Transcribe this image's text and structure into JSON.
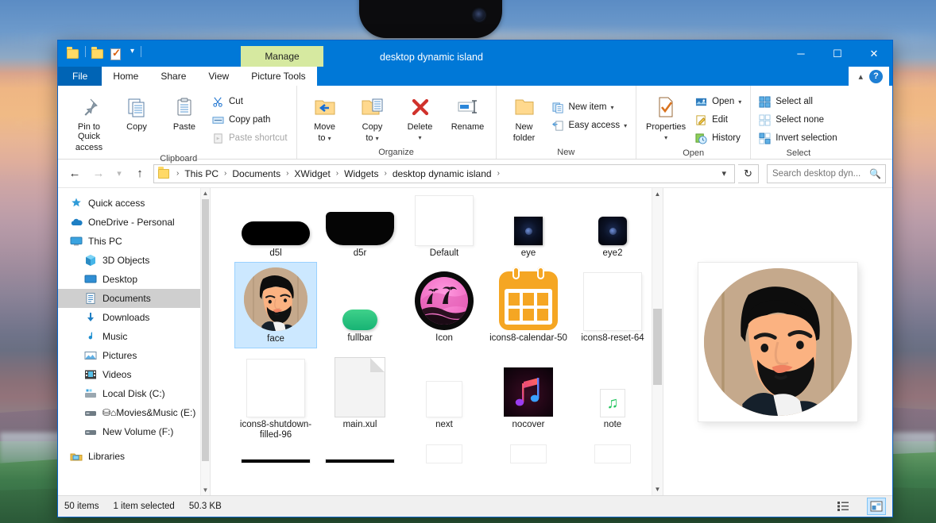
{
  "window": {
    "title": "desktop dynamic island",
    "contextual_tab": "Manage",
    "controls": {
      "minimize": "─",
      "maximize": "☐",
      "close": "✕"
    }
  },
  "quick_access_toolbar": {
    "items": [
      {
        "name": "properties-qat",
        "icon": "properties-icon"
      },
      {
        "name": "new-folder-qat",
        "icon": "folder-icon"
      },
      {
        "name": "customize-qat",
        "icon": "chevron-down-icon"
      }
    ]
  },
  "ribbon": {
    "tabs": [
      {
        "label": "File",
        "id": "file"
      },
      {
        "label": "Home",
        "id": "home"
      },
      {
        "label": "Share",
        "id": "share"
      },
      {
        "label": "View",
        "id": "view"
      },
      {
        "label": "Picture Tools",
        "id": "picture-tools"
      }
    ],
    "active_tab": "Home",
    "collapse_icon": "chevron-up-icon",
    "help_label": "?",
    "groups": [
      {
        "label": "Clipboard",
        "big_buttons": [
          {
            "label": "Pin to Quick\naccess",
            "line1": "Pin to Quick",
            "line2": "access",
            "icon": "pin-icon"
          },
          {
            "label": "Copy",
            "line1": "Copy",
            "line2": "",
            "icon": "copy-icon"
          },
          {
            "label": "Paste",
            "line1": "Paste",
            "line2": "",
            "icon": "paste-icon"
          }
        ],
        "small_buttons": [
          {
            "label": "Cut",
            "icon": "scissors-icon",
            "disabled": false
          },
          {
            "label": "Copy path",
            "icon": "copy-path-icon",
            "disabled": false
          },
          {
            "label": "Paste shortcut",
            "icon": "paste-shortcut-icon",
            "disabled": true
          }
        ]
      },
      {
        "label": "Organize",
        "big_buttons": [
          {
            "line1": "Move",
            "line2": "to",
            "icon": "move-to-icon",
            "has_caret": true
          },
          {
            "line1": "Copy",
            "line2": "to",
            "icon": "copy-to-icon",
            "has_caret": true
          },
          {
            "line1": "Delete",
            "line2": "",
            "icon": "delete-icon",
            "has_caret": true
          },
          {
            "line1": "Rename",
            "line2": "",
            "icon": "rename-icon",
            "has_caret": false
          }
        ],
        "small_buttons": []
      },
      {
        "label": "New",
        "big_buttons": [
          {
            "line1": "New",
            "line2": "folder",
            "icon": "new-folder-icon",
            "has_caret": false
          }
        ],
        "small_buttons": [
          {
            "label": "New item",
            "icon": "new-item-icon",
            "has_caret": true
          },
          {
            "label": "Easy access",
            "icon": "easy-access-icon",
            "has_caret": true
          }
        ]
      },
      {
        "label": "Open",
        "big_buttons": [
          {
            "line1": "Properties",
            "line2": "",
            "icon": "properties-icon",
            "has_caret": true
          }
        ],
        "small_buttons": [
          {
            "label": "Open",
            "icon": "open-icon",
            "has_caret": true
          },
          {
            "label": "Edit",
            "icon": "edit-icon",
            "has_caret": false
          },
          {
            "label": "History",
            "icon": "history-icon",
            "has_caret": false
          }
        ]
      },
      {
        "label": "Select",
        "big_buttons": [],
        "small_buttons": [
          {
            "label": "Select all",
            "icon": "select-all-icon"
          },
          {
            "label": "Select none",
            "icon": "select-none-icon"
          },
          {
            "label": "Invert selection",
            "icon": "invert-selection-icon"
          }
        ]
      }
    ]
  },
  "navigation": {
    "back_icon": "arrow-left-icon",
    "forward_icon": "arrow-right-icon",
    "recent_icon": "chevron-down-icon",
    "up_icon": "arrow-up-icon",
    "breadcrumb": [
      "This PC",
      "Documents",
      "XWidget",
      "Widgets",
      "desktop dynamic island"
    ],
    "breadcrumb_separator": "›",
    "dropdown_icon": "chevron-down-icon",
    "refresh_icon": "refresh-icon"
  },
  "search": {
    "value": "",
    "placeholder": "Search desktop dyn...",
    "icon": "search-icon"
  },
  "sidebar": {
    "items": [
      {
        "label": "Quick access",
        "icon": "star-icon",
        "indent": false,
        "selected": false
      },
      {
        "label": "OneDrive - Personal",
        "icon": "cloud-icon",
        "indent": false,
        "selected": false
      },
      {
        "label": "This PC",
        "icon": "monitor-icon",
        "indent": false,
        "selected": false
      },
      {
        "label": "3D Objects",
        "icon": "cube-icon",
        "indent": true,
        "selected": false
      },
      {
        "label": "Desktop",
        "icon": "desktop-icon",
        "indent": true,
        "selected": false
      },
      {
        "label": "Documents",
        "icon": "documents-icon",
        "indent": true,
        "selected": true
      },
      {
        "label": "Downloads",
        "icon": "download-icon",
        "indent": true,
        "selected": false
      },
      {
        "label": "Music",
        "icon": "music-note-icon",
        "indent": true,
        "selected": false
      },
      {
        "label": "Pictures",
        "icon": "pictures-icon",
        "indent": true,
        "selected": false
      },
      {
        "label": "Videos",
        "icon": "videos-icon",
        "indent": true,
        "selected": false
      },
      {
        "label": "Local Disk (C:)",
        "icon": "hard-drive-icon",
        "indent": true,
        "selected": false
      },
      {
        "label": "⛁⌂Movies&Music (E:)",
        "icon": "drive-icon",
        "indent": true,
        "selected": false
      },
      {
        "label": "New Volume (F:)",
        "icon": "drive-icon",
        "indent": true,
        "selected": false
      },
      {
        "label": "Libraries",
        "icon": "libraries-icon",
        "indent": false,
        "selected": false
      }
    ]
  },
  "files": {
    "items": [
      {
        "label": "d5l",
        "thumb": "black-pill",
        "selected": false
      },
      {
        "label": "d5r",
        "thumb": "black-rounded",
        "selected": false
      },
      {
        "label": "Default",
        "thumb": "blank-white",
        "selected": false
      },
      {
        "label": "eye",
        "thumb": "eye-dark",
        "selected": false
      },
      {
        "label": "eye2",
        "thumb": "eye-dark-round",
        "selected": false
      },
      {
        "label": "face",
        "thumb": "face-avatar",
        "selected": true
      },
      {
        "label": "fullbar",
        "thumb": "green-pill",
        "selected": false
      },
      {
        "label": "Icon",
        "thumb": "pink-island-circle",
        "selected": false
      },
      {
        "label": "icons8-calendar-50",
        "thumb": "orange-calendar",
        "selected": false
      },
      {
        "label": "icons8-reset-64",
        "thumb": "blank-white",
        "selected": false
      },
      {
        "label": "icons8-shutdown-filled-96",
        "thumb": "blank-white",
        "selected": false
      },
      {
        "label": "main.xul",
        "thumb": "file-page",
        "selected": false
      },
      {
        "label": "next",
        "thumb": "small-blank",
        "selected": false
      },
      {
        "label": "nocover",
        "thumb": "music-cover",
        "selected": false
      },
      {
        "label": "note",
        "thumb": "green-note",
        "selected": false
      }
    ],
    "partial_row": [
      {
        "thumb": "black-bar"
      },
      {
        "thumb": "black-bar"
      },
      {
        "thumb": "blank-partial"
      },
      {
        "thumb": "blank-partial"
      },
      {
        "thumb": "blank-partial"
      }
    ]
  },
  "preview": {
    "name": "face-preview"
  },
  "statusbar": {
    "item_count": "50 items",
    "selection": "1 item selected",
    "size": "50.3 KB",
    "view_buttons": [
      {
        "name": "details-view-button",
        "icon": "details-view-icon",
        "active": false
      },
      {
        "name": "large-icons-view-button",
        "icon": "large-icons-view-icon",
        "active": true
      }
    ]
  },
  "colors": {
    "accent": "#0078d7",
    "selection": "#cce8ff",
    "contextual_tab": "#d6e9a0",
    "sidebar_selected": "#cfcfcf"
  }
}
